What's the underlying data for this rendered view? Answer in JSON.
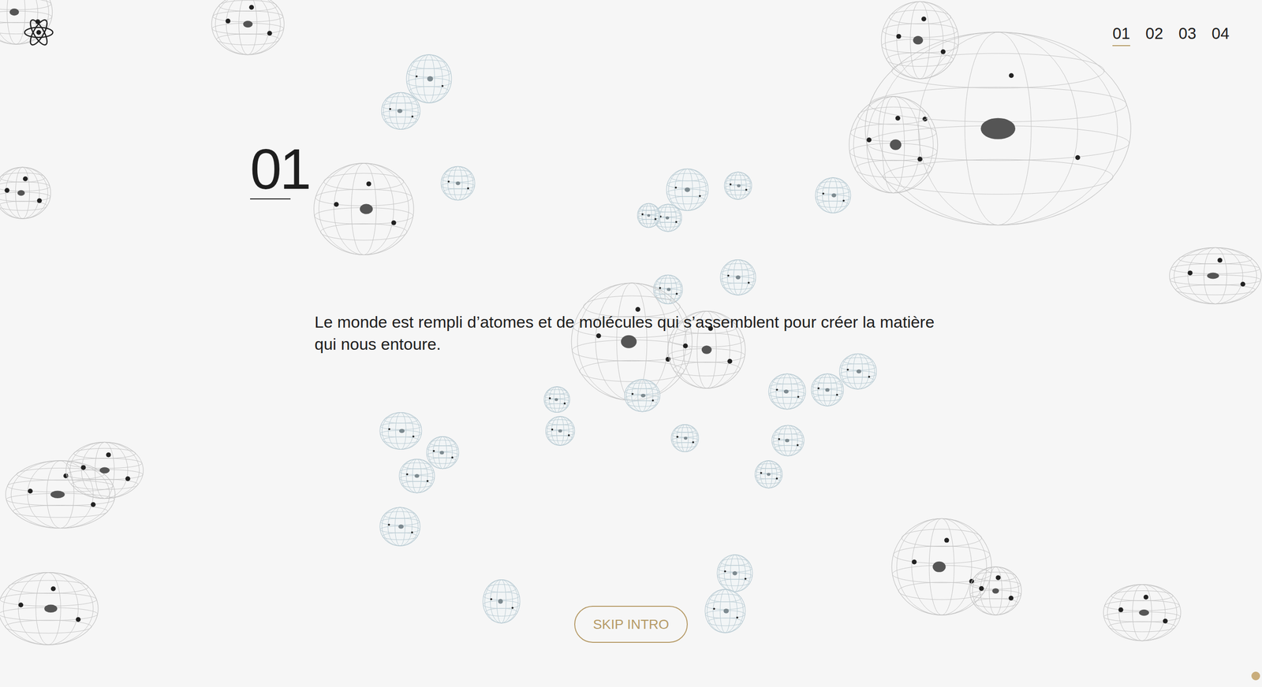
{
  "logo": {
    "label": "atom"
  },
  "nav": [
    {
      "label": "01",
      "selected": true
    },
    {
      "label": "02",
      "selected": false
    },
    {
      "label": "03",
      "selected": false
    },
    {
      "label": "04",
      "selected": false
    }
  ],
  "slide": {
    "number": "01",
    "text": "Le monde est rempli d’atomes et de molécules qui s’assemblent pour créer la matière qui nous entoure."
  },
  "skip_button": {
    "label": "SKIP INTRO"
  }
}
